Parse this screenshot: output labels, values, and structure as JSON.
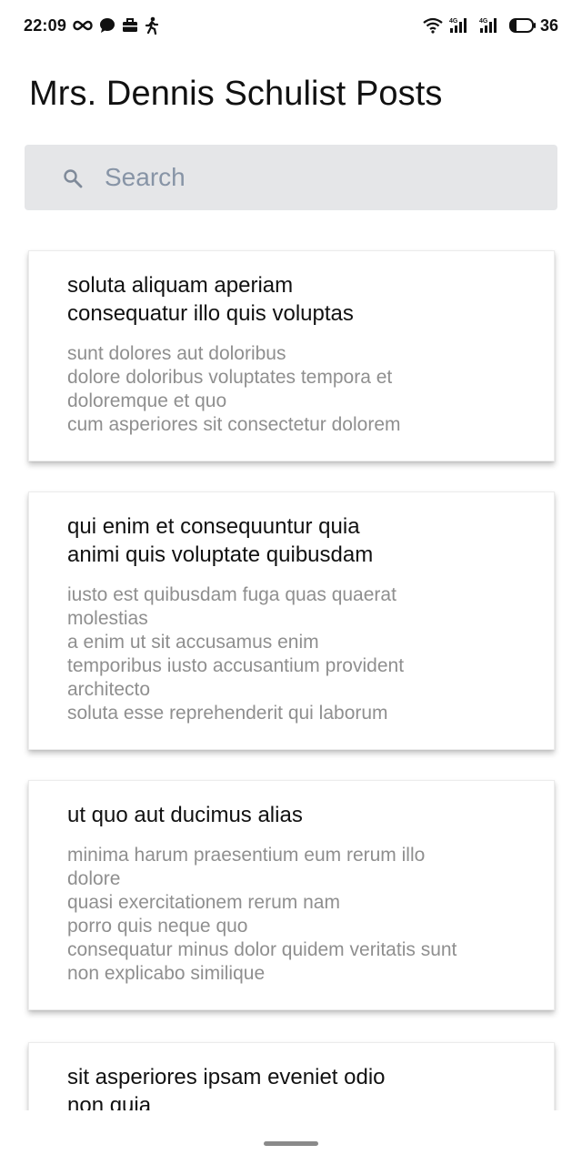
{
  "status_bar": {
    "time": "22:09",
    "battery": "36",
    "icons_left": [
      "infinity-icon",
      "chat-bubble-icon",
      "briefcase-icon",
      "walking-person-icon"
    ],
    "icons_right": [
      "wifi-icon",
      "signal-4g-icon",
      "signal-4g-icon",
      "battery-icon"
    ],
    "network_label": "4G"
  },
  "header": {
    "title": "Mrs. Dennis Schulist Posts"
  },
  "search": {
    "placeholder": "Search",
    "value": ""
  },
  "posts": [
    {
      "title": "soluta aliquam aperiam\nconsequatur illo quis voluptas",
      "body": "sunt dolores aut doloribus\ndolore doloribus voluptates tempora et\ndoloremque et quo\ncum asperiores sit consectetur dolorem"
    },
    {
      "title": "qui enim et consequuntur quia\nanimi quis voluptate quibusdam",
      "body": "iusto est quibusdam fuga quas quaerat\nmolestias\na enim ut sit accusamus enim\ntemporibus iusto accusantium provident\narchitecto\nsoluta esse reprehenderit qui laborum"
    },
    {
      "title": "ut quo aut ducimus alias",
      "body": "minima harum praesentium eum rerum illo\ndolore\nquasi exercitationem rerum nam\nporro quis neque quo\nconsequatur minus dolor quidem veritatis sunt\nnon explicabo similique"
    },
    {
      "title": "sit asperiores ipsam eveniet odio\nnon quia",
      "body": ""
    }
  ],
  "colors": {
    "search_bg": "#e5e6e8",
    "placeholder": "#8794a6",
    "body_text": "#8f8f8f",
    "title_text": "#111111"
  }
}
